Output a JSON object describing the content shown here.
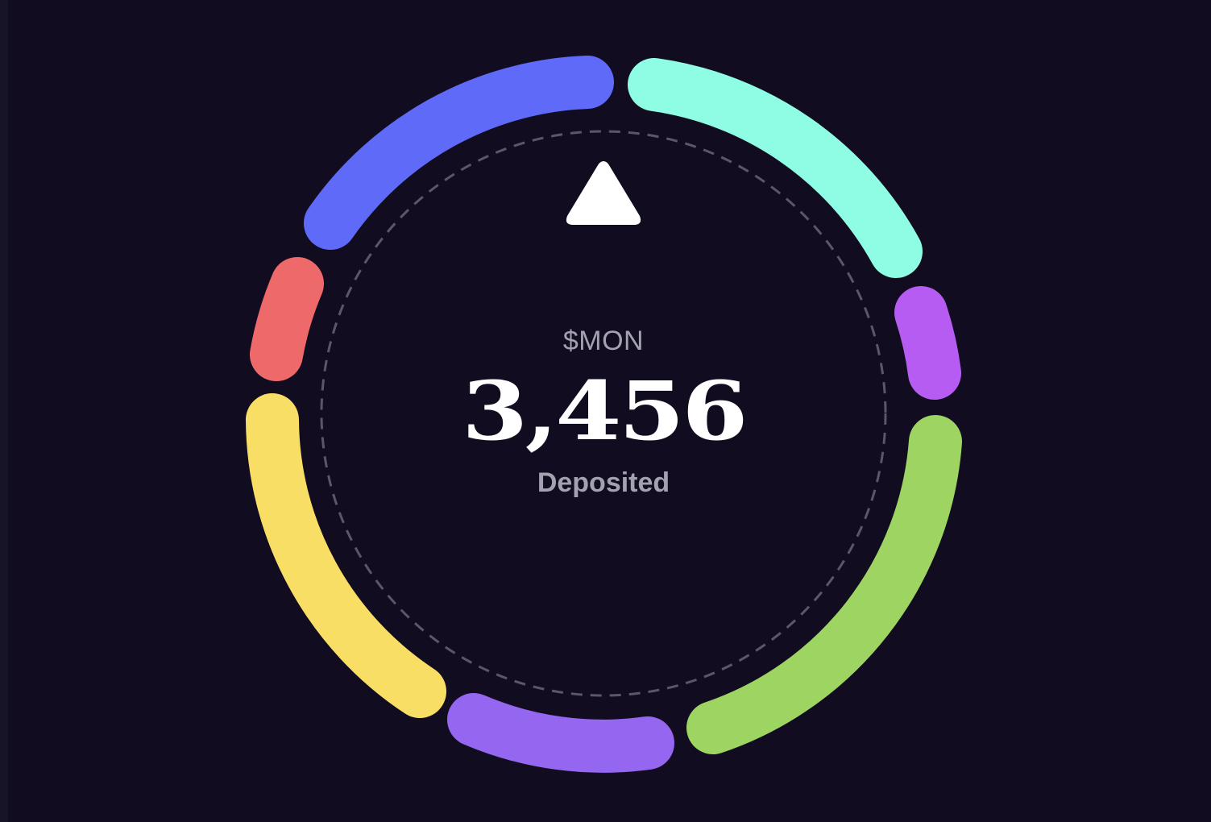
{
  "wheel": {
    "token_label": "$MON",
    "amount": "3,456",
    "status_label": "Deposited",
    "pointer_icon": "triangle-up-icon",
    "segments": [
      {
        "color": "#5f6af8"
      },
      {
        "color": "#8ffde3"
      },
      {
        "color": "#b65cf2"
      },
      {
        "color": "#9dd462"
      },
      {
        "color": "#9566f0"
      },
      {
        "color": "#f9de66"
      },
      {
        "color": "#ee6a6a"
      }
    ]
  },
  "colors": {
    "background": "#120c20",
    "ring_dash": "#5a5768",
    "pointer": "#ffffff",
    "text_primary": "#ffffff",
    "text_muted": "#a3a2b0"
  }
}
